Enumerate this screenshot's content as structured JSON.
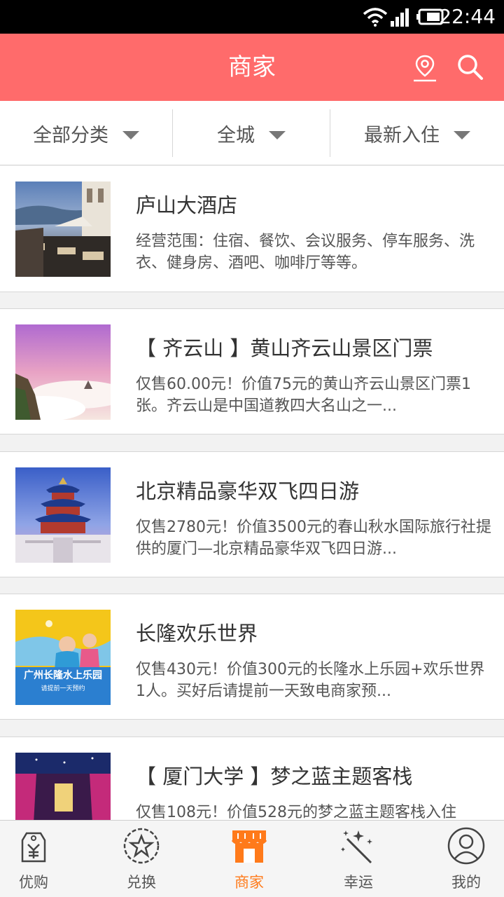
{
  "status": {
    "time": "22:44"
  },
  "header": {
    "title": "商家"
  },
  "filters": [
    {
      "label": "全部分类"
    },
    {
      "label": "全城"
    },
    {
      "label": "最新入住"
    }
  ],
  "items": [
    {
      "title": "庐山大酒店",
      "desc": "经营范围：住宿、餐饮、会议服务、停车服务、洗衣、健身房、酒吧、咖啡厅等等。"
    },
    {
      "title": "【 齐云山 】黄山齐云山景区门票",
      "desc": "仅售60.00元！价值75元的黄山齐云山景区门票1张。齐云山是中国道教四大名山之一..."
    },
    {
      "title": "北京精品豪华双飞四日游",
      "desc": "仅售2780元！价值3500元的春山秋水国际旅行社提供的厦门—北京精品豪华双飞四日游..."
    },
    {
      "title": "长隆欢乐世界",
      "desc": "仅售430元！价值300元的长隆水上乐园+欢乐世界1人。买好后请提前一天致电商家预...",
      "thumb_text": "广州长隆水上乐园",
      "thumb_subtext": "请提前一天预约"
    },
    {
      "title": "【 厦门大学 】梦之蓝主题客栈",
      "desc": "仅售108元！价值528元的梦之蓝主题客栈入住"
    }
  ],
  "tabs": [
    {
      "label": "优购",
      "icon": "price-tag-icon",
      "active": false
    },
    {
      "label": "兑换",
      "icon": "star-badge-icon",
      "active": false
    },
    {
      "label": "商家",
      "icon": "storefront-icon",
      "active": true
    },
    {
      "label": "幸运",
      "icon": "magic-wand-icon",
      "active": false
    },
    {
      "label": "我的",
      "icon": "user-icon",
      "active": false
    }
  ],
  "colors": {
    "header": "#ff6b6b",
    "active_tab": "#ff7a1a"
  }
}
